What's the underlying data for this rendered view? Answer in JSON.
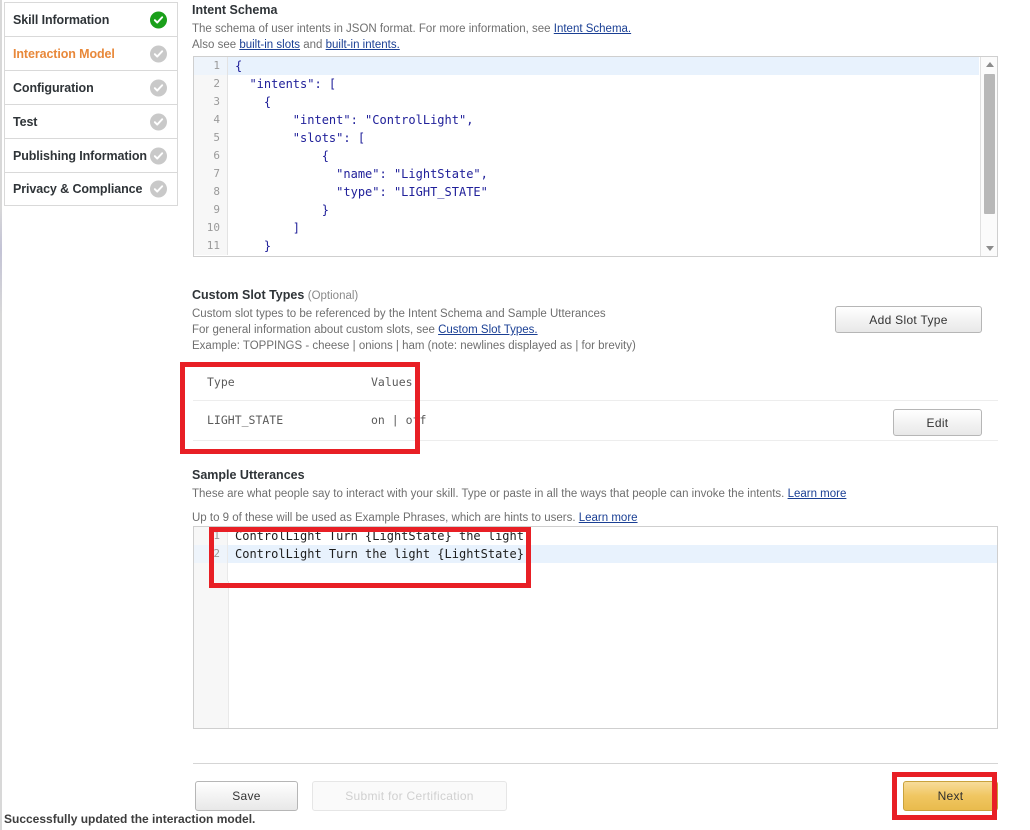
{
  "sidebar": {
    "items": [
      {
        "label": "Skill Information",
        "state": "complete",
        "active": false
      },
      {
        "label": "Interaction Model",
        "state": "incomplete",
        "active": true
      },
      {
        "label": "Configuration",
        "state": "incomplete",
        "active": false
      },
      {
        "label": "Test",
        "state": "incomplete",
        "active": false
      },
      {
        "label": "Publishing Information",
        "state": "incomplete",
        "active": false
      },
      {
        "label": "Privacy & Compliance",
        "state": "incomplete",
        "active": false
      }
    ]
  },
  "intent_schema": {
    "title": "Intent Schema",
    "desc_line1_pre": "The schema of user intents in JSON format. For more information, see ",
    "desc_line1_link": "Intent Schema.",
    "desc_line2_pre": "Also see ",
    "desc_line2_link1": "built-in slots",
    "desc_line2_mid": " and ",
    "desc_line2_link2": "built-in intents.",
    "lines": [
      {
        "n": "1",
        "text": "{",
        "highlight": true
      },
      {
        "n": "2",
        "text": "  \"intents\": [",
        "highlight": false
      },
      {
        "n": "3",
        "text": "    {",
        "highlight": false
      },
      {
        "n": "4",
        "text": "        \"intent\": \"ControlLight\",",
        "highlight": false
      },
      {
        "n": "5",
        "text": "        \"slots\": [",
        "highlight": false
      },
      {
        "n": "6",
        "text": "            {",
        "highlight": false
      },
      {
        "n": "7",
        "text": "              \"name\": \"LightState\",",
        "highlight": false
      },
      {
        "n": "8",
        "text": "              \"type\": \"LIGHT_STATE\"",
        "highlight": false
      },
      {
        "n": "9",
        "text": "            }",
        "highlight": false
      },
      {
        "n": "10",
        "text": "        ]",
        "highlight": false
      },
      {
        "n": "11",
        "text": "    }",
        "highlight": false
      }
    ]
  },
  "custom_slot_types": {
    "title": "Custom Slot Types",
    "optional": "(Optional)",
    "desc_line1": "Custom slot types to be referenced by the Intent Schema and Sample Utterances",
    "desc_line2_pre": "For general information about custom slots, see ",
    "desc_line2_link": "Custom Slot Types.",
    "desc_line3": "Example: TOPPINGS - cheese | onions | ham (note: newlines displayed as | for brevity)",
    "add_button": "Add Slot Type",
    "columns": [
      "Type",
      "Values"
    ],
    "rows": [
      {
        "type": "LIGHT_STATE",
        "values": "on | off",
        "edit_label": "Edit"
      }
    ]
  },
  "sample_utterances": {
    "title": "Sample Utterances",
    "desc_line1_pre": "These are what people say to interact with your skill. Type or paste in all the ways that people can invoke the intents. ",
    "desc_line1_link": "Learn more",
    "desc_line2_pre": "Up to 9 of these will be used as Example Phrases, which are hints to users. ",
    "desc_line2_link": "Learn more",
    "lines": [
      {
        "n": "1",
        "text": "ControlLight Turn {LightState} the light",
        "highlight": false
      },
      {
        "n": "2",
        "text": "ControlLight Turn the light {LightState}",
        "highlight": true
      }
    ]
  },
  "footer": {
    "save_label": "Save",
    "submit_label": "Submit for Certification",
    "next_label": "Next",
    "status_message": "Successfully updated the interaction model."
  },
  "colors": {
    "accent_active": "#e8883a",
    "check_done": "#1aa01a",
    "check_pending": "#c9c9c9",
    "link": "#1a3f94",
    "annotation": "#e81f25",
    "primary_button": "#f0c661",
    "active_line": "#e8f2fd"
  }
}
